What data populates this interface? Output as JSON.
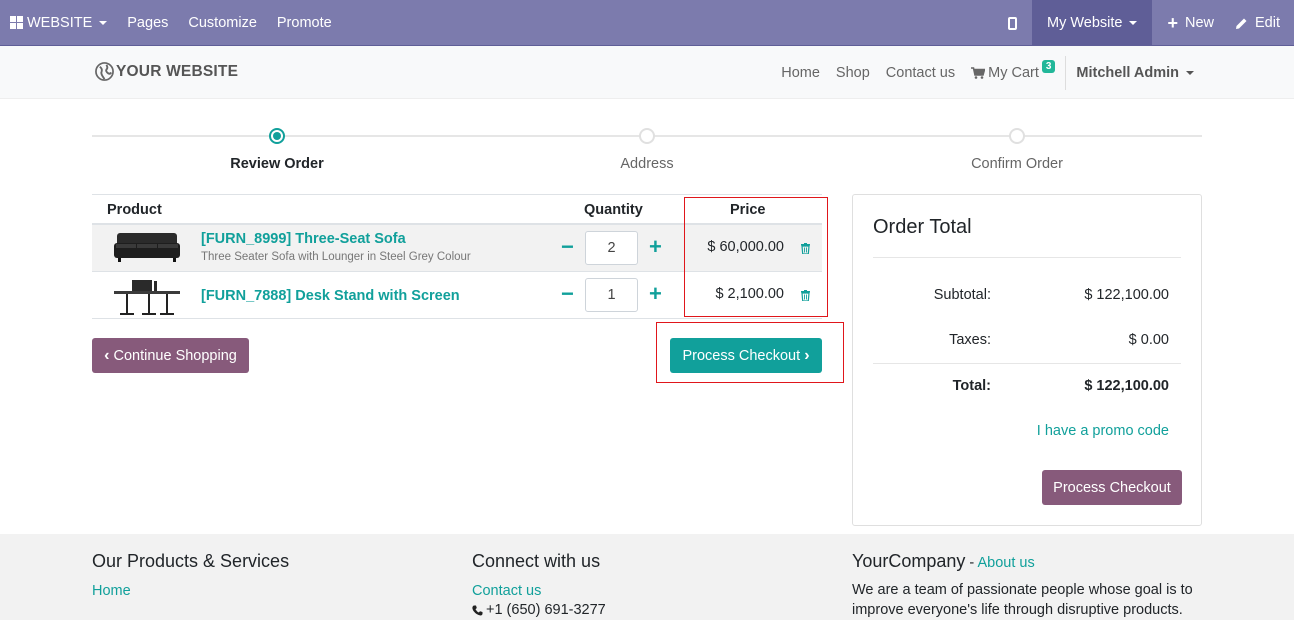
{
  "topbar": {
    "brand": "WEBSITE",
    "menu": [
      "Pages",
      "Customize",
      "Promote"
    ],
    "my_website": "My Website",
    "new": "New",
    "edit": "Edit"
  },
  "header": {
    "logo": "YOUR WEBSITE",
    "nav": [
      "Home",
      "Shop",
      "Contact us"
    ],
    "cart_label": "My Cart",
    "cart_count": "3",
    "user": "Mitchell Admin"
  },
  "steps": [
    {
      "label": "Review Order",
      "active": true
    },
    {
      "label": "Address",
      "active": false
    },
    {
      "label": "Confirm Order",
      "active": false
    }
  ],
  "cart": {
    "headers": {
      "product": "Product",
      "quantity": "Quantity",
      "price": "Price"
    },
    "items": [
      {
        "name": "[FURN_8999] Three-Seat Sofa",
        "description": "Three Seater Sofa with Lounger in Steel Grey Colour",
        "quantity": "2",
        "price": "$ 60,000.00"
      },
      {
        "name": "[FURN_7888] Desk Stand with Screen",
        "description": "",
        "quantity": "1",
        "price": "$ 2,100.00"
      }
    ],
    "continue_label": "Continue Shopping",
    "process_label": "Process Checkout"
  },
  "summary": {
    "title": "Order Total",
    "subtotal_label": "Subtotal:",
    "subtotal": "$ 122,100.00",
    "taxes_label": "Taxes:",
    "taxes": "$ 0.00",
    "total_label": "Total:",
    "total": "$ 122,100.00",
    "promo": "I have a promo code",
    "process_label": "Process Checkout"
  },
  "footer": {
    "col1_title": "Our Products & Services",
    "col1_link": "Home",
    "col2_title": "Connect with us",
    "col2_link": "Contact us",
    "col2_phone": "+1 (650) 691-3277",
    "col3_title": "YourCompany",
    "col3_sep": " - ",
    "col3_about": "About us",
    "col3_text": "We are a team of passionate people whose goal is to improve everyone's life through disruptive products. We"
  },
  "colors": {
    "accent": "#11a09b",
    "brand": "#875a7b",
    "topbar": "#7c7bad",
    "annotation": "#e0161b"
  }
}
